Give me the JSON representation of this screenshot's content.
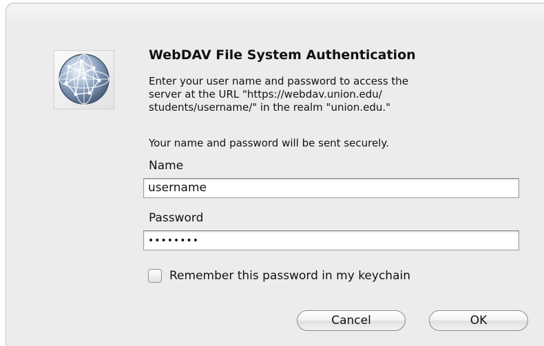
{
  "dialog": {
    "title": "WebDAV File System Authentication",
    "message_lines": [
      "Enter your user name and password to access the",
      "server at the URL \"https://webdav.union.edu/",
      "students/username/\" in the realm \"union.edu.\""
    ],
    "secure_note": "Your name and password will be sent securely.",
    "icon": "network-globe-icon"
  },
  "form": {
    "name_label": "Name",
    "name_value": "username",
    "password_label": "Password",
    "password_value": "••••••••",
    "remember_label": "Remember this password in my keychain",
    "remember_checked": false
  },
  "buttons": {
    "cancel_label": "Cancel",
    "ok_label": "OK"
  }
}
